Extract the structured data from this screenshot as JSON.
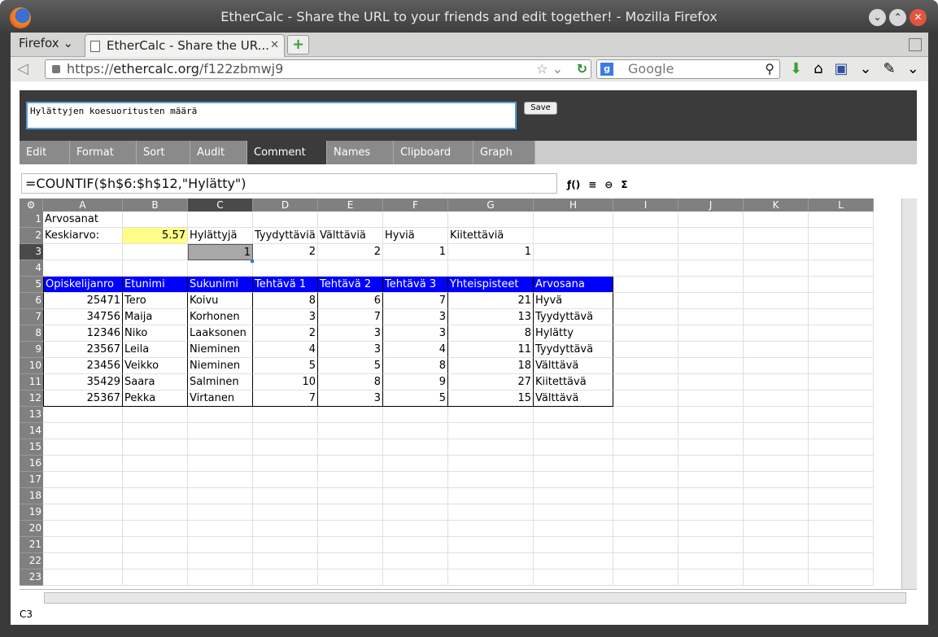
{
  "window": {
    "title": "EtherCalc - Share the URL to your friends and edit together! - Mozilla Firefox"
  },
  "browser": {
    "menu_label": "Firefox",
    "tab_title": "EtherCalc - Share the UR...",
    "url_prefix": "https://",
    "url_domain": "ethercalc.org",
    "url_path": "/f122zbmwj9",
    "search_placeholder": "Google"
  },
  "comment": {
    "text": "Hylättyjen koesuoritusten määrä",
    "save_label": "Save"
  },
  "menu": [
    "Edit",
    "Format",
    "Sort",
    "Audit",
    "Comment",
    "Names",
    "Clipboard",
    "Graph"
  ],
  "active_menu": "Comment",
  "formula": "=COUNTIF($h$6:$h$12,\"Hylätty\")",
  "columns": [
    "A",
    "B",
    "C",
    "D",
    "E",
    "F",
    "G",
    "H",
    "I",
    "J",
    "K",
    "L"
  ],
  "selected_cell": "C3",
  "rows": [
    [
      "Arvosanat",
      "",
      "",
      "",
      "",
      "",
      "",
      ""
    ],
    [
      "Keskiarvo:",
      "5.57",
      "Hylättyjä",
      "Tyydyttäviä",
      "Välttäviä",
      "Hyviä",
      "Kiitettäviä",
      ""
    ],
    [
      "",
      "",
      "1",
      "2",
      "2",
      "1",
      "1",
      ""
    ],
    [
      "",
      "",
      "",
      "",
      "",
      "",
      "",
      ""
    ],
    [
      "Opiskelijanro",
      "Etunimi",
      "Sukunimi",
      "Tehtävä 1",
      "Tehtävä 2",
      "Tehtävä 3",
      "Yhteispisteet",
      "Arvosana"
    ],
    [
      "25471",
      "Tero",
      "Koivu",
      "8",
      "6",
      "7",
      "21",
      "Hyvä"
    ],
    [
      "34756",
      "Maija",
      "Korhonen",
      "3",
      "7",
      "3",
      "13",
      "Tyydyttävä"
    ],
    [
      "12346",
      "Niko",
      "Laaksonen",
      "2",
      "3",
      "3",
      "8",
      "Hylätty"
    ],
    [
      "23567",
      "Leila",
      "Nieminen",
      "4",
      "3",
      "4",
      "11",
      "Tyydyttävä"
    ],
    [
      "23456",
      "Veikko",
      "Nieminen",
      "5",
      "5",
      "8",
      "18",
      "Välttävä"
    ],
    [
      "35429",
      "Saara",
      "Salminen",
      "10",
      "8",
      "9",
      "27",
      "Kiitettävä"
    ],
    [
      "25367",
      "Pekka",
      "Virtanen",
      "7",
      "3",
      "5",
      "15",
      "Välttävä"
    ]
  ],
  "row_numbers": [
    "1",
    "2",
    "3",
    "4",
    "5",
    "6",
    "7",
    "8",
    "9",
    "10",
    "11",
    "12",
    "13",
    "14",
    "15",
    "16",
    "17",
    "18",
    "19",
    "20",
    "21",
    "22",
    "23"
  ],
  "status_cell": "C3",
  "colors": {
    "header_fill": "#0000ff",
    "highlight": "#ffff88",
    "selected": "#a8a8a8"
  }
}
